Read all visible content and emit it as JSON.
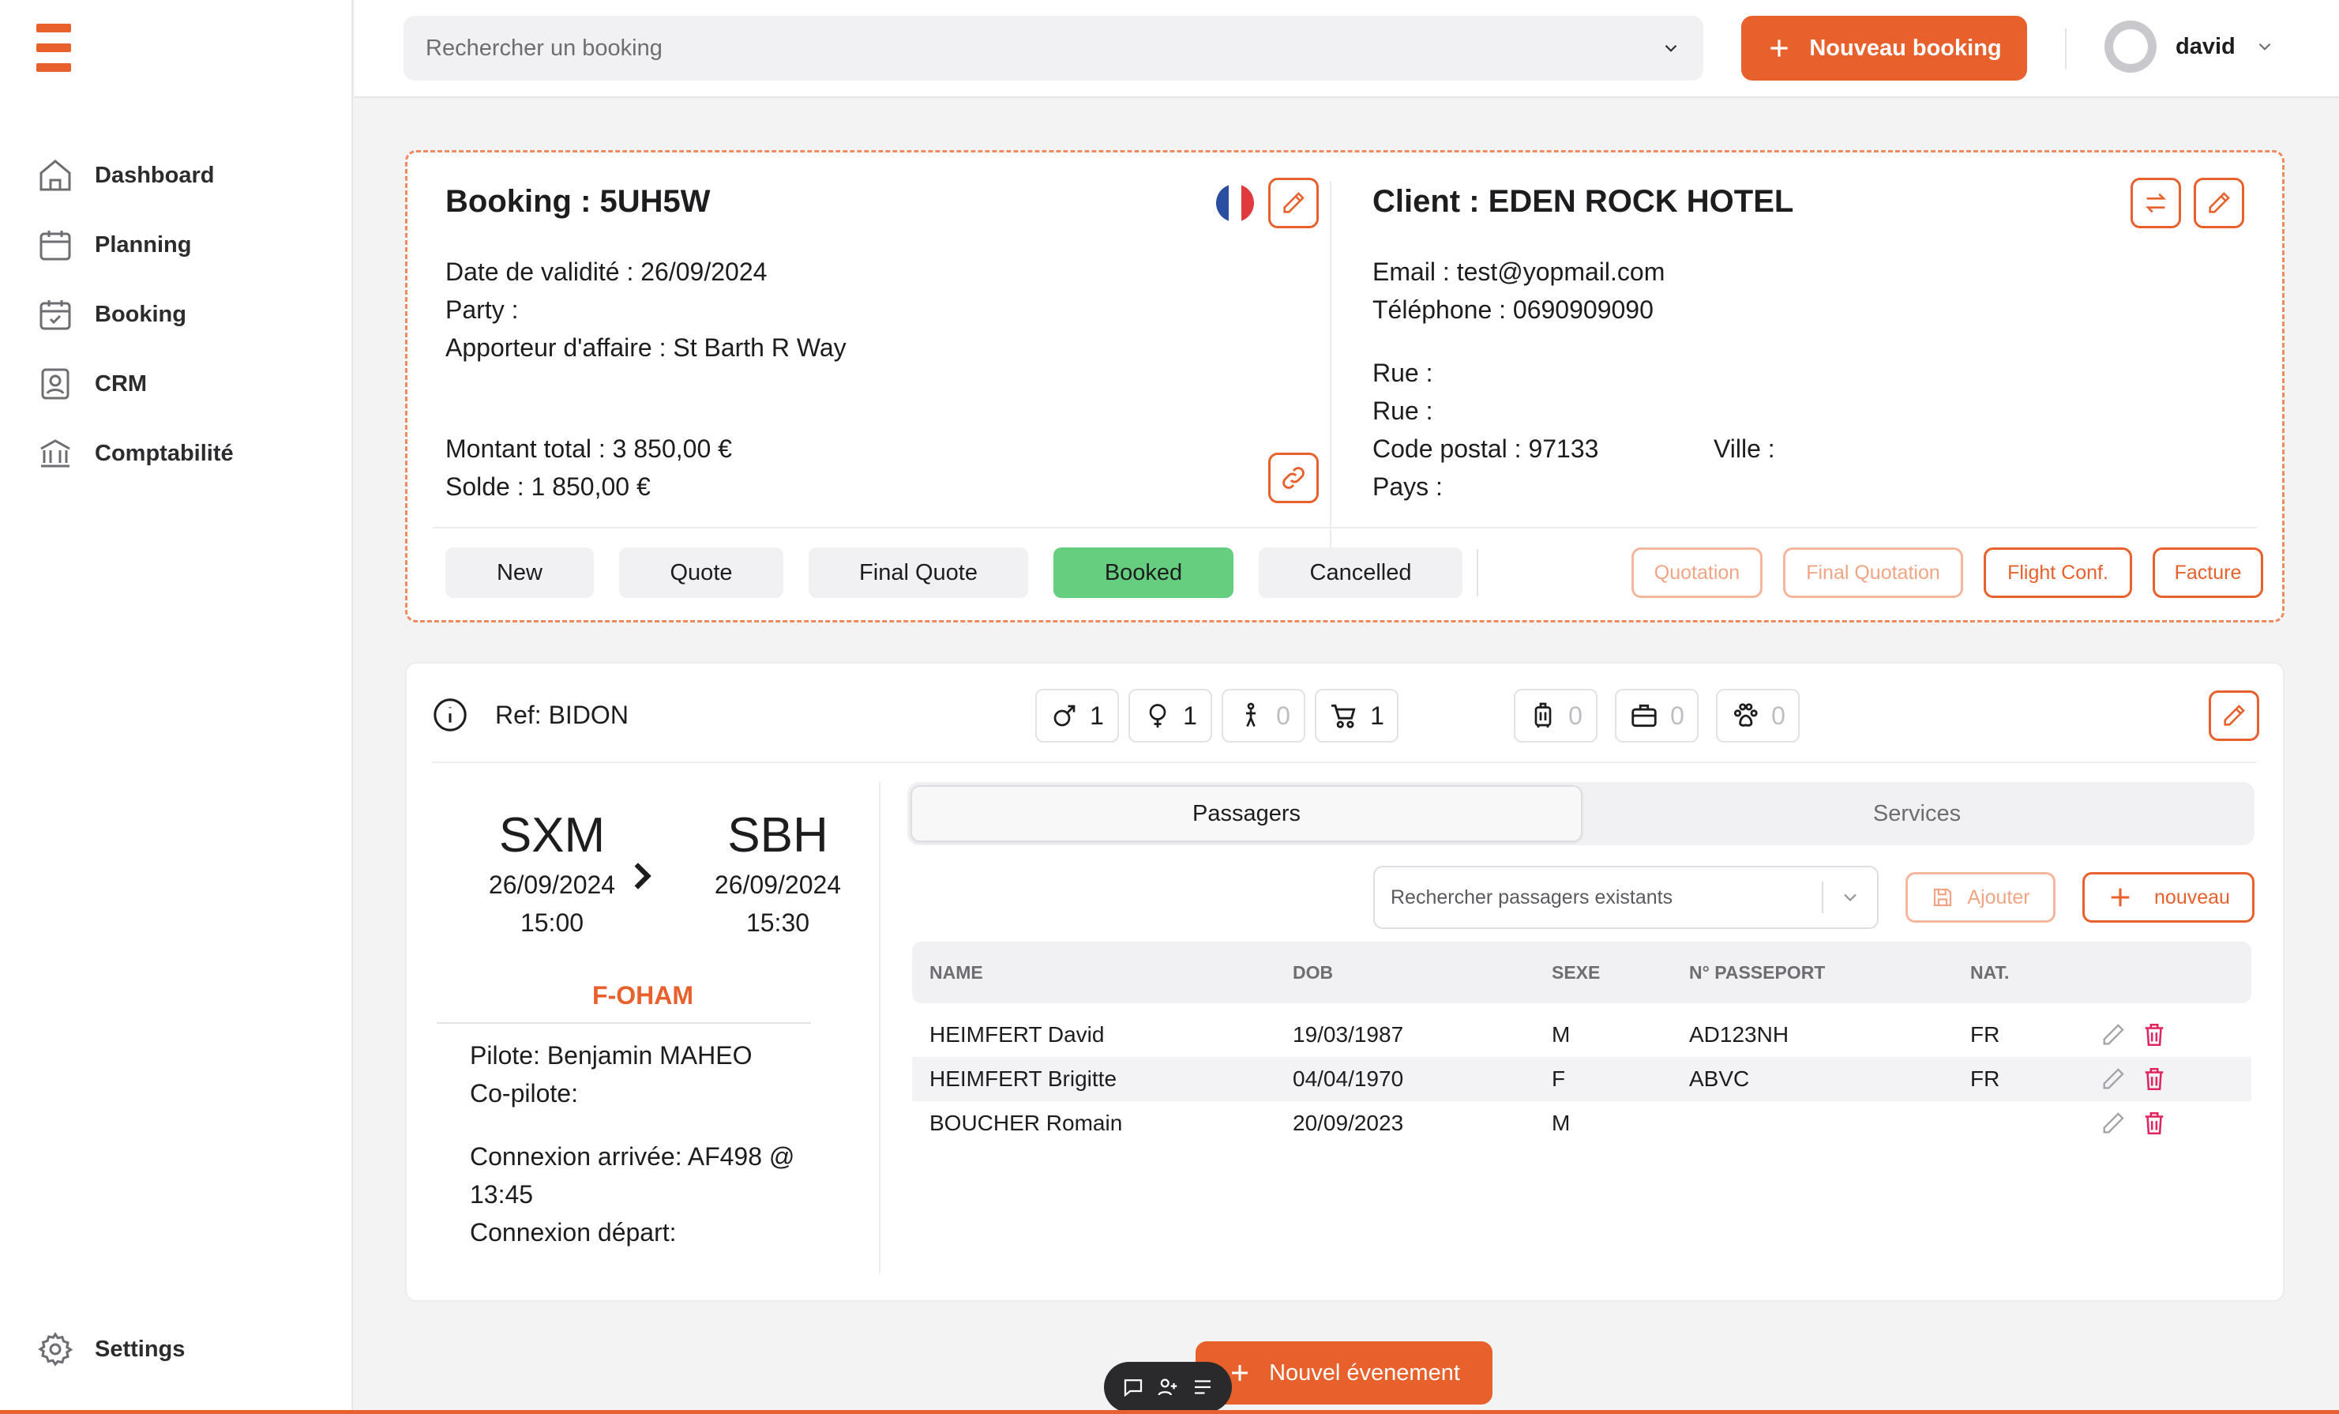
{
  "sidebar": {
    "items": [
      {
        "label": "Dashboard",
        "icon": "home-icon"
      },
      {
        "label": "Planning",
        "icon": "calendar-icon"
      },
      {
        "label": "Booking",
        "icon": "calendar-check-icon"
      },
      {
        "label": "CRM",
        "icon": "contact-card-icon"
      },
      {
        "label": "Comptabilité",
        "icon": "bank-icon"
      }
    ],
    "settings_label": "Settings"
  },
  "topbar": {
    "search_placeholder": "Rechercher un booking",
    "new_booking_label": "Nouveau booking",
    "user_name": "david"
  },
  "booking": {
    "title": "Booking : 5UH5W",
    "validity": "Date de validité : 26/09/2024",
    "party": "Party :",
    "apporteur": "Apporteur d'affaire : St Barth R Way",
    "total": "Montant total : 3 850,00 €",
    "solde": "Solde : 1 850,00 €"
  },
  "client": {
    "title": "Client : EDEN ROCK HOTEL",
    "email": "Email : test@yopmail.com",
    "phone": "Téléphone : 0690909090",
    "rue1": "Rue :",
    "rue2": "Rue :",
    "postal": "Code postal : 97133",
    "ville": "Ville :",
    "pays": "Pays :"
  },
  "statuses": [
    {
      "label": "New",
      "active": false
    },
    {
      "label": "Quote",
      "active": false
    },
    {
      "label": "Final Quote",
      "active": false
    },
    {
      "label": "Booked",
      "active": true
    },
    {
      "label": "Cancelled",
      "active": false
    }
  ],
  "documents": [
    {
      "label": "Quotation",
      "enabled": false
    },
    {
      "label": "Final Quotation",
      "enabled": false
    },
    {
      "label": "Flight Conf.",
      "enabled": true
    },
    {
      "label": "Facture",
      "enabled": true
    }
  ],
  "flight": {
    "ref": "Ref: BIDON",
    "counts": {
      "male": "1",
      "female": "1",
      "child": "0",
      "infant": "1",
      "luggage": "0",
      "bag": "0",
      "pet": "0"
    },
    "from": {
      "code": "SXM",
      "date": "26/09/2024",
      "time": "15:00"
    },
    "to": {
      "code": "SBH",
      "date": "26/09/2024",
      "time": "15:30"
    },
    "registration": "F-OHAM",
    "pilote": "Pilote: Benjamin MAHEO",
    "copilote": "Co-pilote:",
    "connexion_arrivee": "Connexion arrivée: AF498 @ 13:45",
    "connexion_depart": "Connexion départ:"
  },
  "tabs": [
    {
      "label": "Passagers",
      "active": true
    },
    {
      "label": "Services",
      "active": false
    }
  ],
  "passengers": {
    "search_placeholder": "Rechercher passagers existants",
    "add_label": "Ajouter",
    "new_label": "nouveau",
    "columns": [
      "NAME",
      "DOB",
      "SEXE",
      "N° PASSEPORT",
      "NAT."
    ],
    "rows": [
      {
        "name": "HEIMFERT David",
        "dob": "19/03/1987",
        "sexe": "M",
        "passport": "AD123NH",
        "nat": "FR"
      },
      {
        "name": "HEIMFERT Brigitte",
        "dob": "04/04/1970",
        "sexe": "F",
        "passport": "ABVC",
        "nat": "FR"
      },
      {
        "name": "BOUCHER Romain",
        "dob": "20/09/2023",
        "sexe": "M",
        "passport": "",
        "nat": ""
      }
    ]
  },
  "bottom": {
    "new_event_label": "Nouvel évenement"
  },
  "colors": {
    "accent": "#e8602c",
    "booked": "#66cf7f",
    "delete": "#e0245e"
  }
}
